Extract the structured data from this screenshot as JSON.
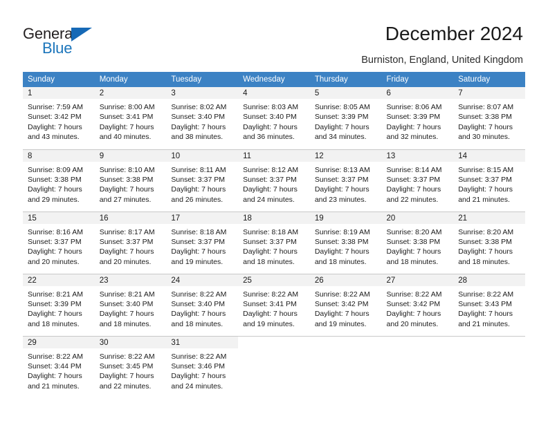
{
  "brand": {
    "name_part1": "General",
    "name_part2": "Blue",
    "triangle_color": "#1669b6",
    "blue_color": "#1b75bb"
  },
  "header": {
    "title": "December 2024",
    "location": "Burniston, England, United Kingdom"
  },
  "theme": {
    "header_row_bg": "#3c82c4",
    "daynum_band_bg": "#f2f2f2",
    "grid_line": "#c8c8c8"
  },
  "weekday_headers": [
    "Sunday",
    "Monday",
    "Tuesday",
    "Wednesday",
    "Thursday",
    "Friday",
    "Saturday"
  ],
  "weeks": [
    [
      {
        "day": "1",
        "sunrise": "Sunrise: 7:59 AM",
        "sunset": "Sunset: 3:42 PM",
        "daylight1": "Daylight: 7 hours",
        "daylight2": "and 43 minutes."
      },
      {
        "day": "2",
        "sunrise": "Sunrise: 8:00 AM",
        "sunset": "Sunset: 3:41 PM",
        "daylight1": "Daylight: 7 hours",
        "daylight2": "and 40 minutes."
      },
      {
        "day": "3",
        "sunrise": "Sunrise: 8:02 AM",
        "sunset": "Sunset: 3:40 PM",
        "daylight1": "Daylight: 7 hours",
        "daylight2": "and 38 minutes."
      },
      {
        "day": "4",
        "sunrise": "Sunrise: 8:03 AM",
        "sunset": "Sunset: 3:40 PM",
        "daylight1": "Daylight: 7 hours",
        "daylight2": "and 36 minutes."
      },
      {
        "day": "5",
        "sunrise": "Sunrise: 8:05 AM",
        "sunset": "Sunset: 3:39 PM",
        "daylight1": "Daylight: 7 hours",
        "daylight2": "and 34 minutes."
      },
      {
        "day": "6",
        "sunrise": "Sunrise: 8:06 AM",
        "sunset": "Sunset: 3:39 PM",
        "daylight1": "Daylight: 7 hours",
        "daylight2": "and 32 minutes."
      },
      {
        "day": "7",
        "sunrise": "Sunrise: 8:07 AM",
        "sunset": "Sunset: 3:38 PM",
        "daylight1": "Daylight: 7 hours",
        "daylight2": "and 30 minutes."
      }
    ],
    [
      {
        "day": "8",
        "sunrise": "Sunrise: 8:09 AM",
        "sunset": "Sunset: 3:38 PM",
        "daylight1": "Daylight: 7 hours",
        "daylight2": "and 29 minutes."
      },
      {
        "day": "9",
        "sunrise": "Sunrise: 8:10 AM",
        "sunset": "Sunset: 3:38 PM",
        "daylight1": "Daylight: 7 hours",
        "daylight2": "and 27 minutes."
      },
      {
        "day": "10",
        "sunrise": "Sunrise: 8:11 AM",
        "sunset": "Sunset: 3:37 PM",
        "daylight1": "Daylight: 7 hours",
        "daylight2": "and 26 minutes."
      },
      {
        "day": "11",
        "sunrise": "Sunrise: 8:12 AM",
        "sunset": "Sunset: 3:37 PM",
        "daylight1": "Daylight: 7 hours",
        "daylight2": "and 24 minutes."
      },
      {
        "day": "12",
        "sunrise": "Sunrise: 8:13 AM",
        "sunset": "Sunset: 3:37 PM",
        "daylight1": "Daylight: 7 hours",
        "daylight2": "and 23 minutes."
      },
      {
        "day": "13",
        "sunrise": "Sunrise: 8:14 AM",
        "sunset": "Sunset: 3:37 PM",
        "daylight1": "Daylight: 7 hours",
        "daylight2": "and 22 minutes."
      },
      {
        "day": "14",
        "sunrise": "Sunrise: 8:15 AM",
        "sunset": "Sunset: 3:37 PM",
        "daylight1": "Daylight: 7 hours",
        "daylight2": "and 21 minutes."
      }
    ],
    [
      {
        "day": "15",
        "sunrise": "Sunrise: 8:16 AM",
        "sunset": "Sunset: 3:37 PM",
        "daylight1": "Daylight: 7 hours",
        "daylight2": "and 20 minutes."
      },
      {
        "day": "16",
        "sunrise": "Sunrise: 8:17 AM",
        "sunset": "Sunset: 3:37 PM",
        "daylight1": "Daylight: 7 hours",
        "daylight2": "and 20 minutes."
      },
      {
        "day": "17",
        "sunrise": "Sunrise: 8:18 AM",
        "sunset": "Sunset: 3:37 PM",
        "daylight1": "Daylight: 7 hours",
        "daylight2": "and 19 minutes."
      },
      {
        "day": "18",
        "sunrise": "Sunrise: 8:18 AM",
        "sunset": "Sunset: 3:37 PM",
        "daylight1": "Daylight: 7 hours",
        "daylight2": "and 18 minutes."
      },
      {
        "day": "19",
        "sunrise": "Sunrise: 8:19 AM",
        "sunset": "Sunset: 3:38 PM",
        "daylight1": "Daylight: 7 hours",
        "daylight2": "and 18 minutes."
      },
      {
        "day": "20",
        "sunrise": "Sunrise: 8:20 AM",
        "sunset": "Sunset: 3:38 PM",
        "daylight1": "Daylight: 7 hours",
        "daylight2": "and 18 minutes."
      },
      {
        "day": "21",
        "sunrise": "Sunrise: 8:20 AM",
        "sunset": "Sunset: 3:38 PM",
        "daylight1": "Daylight: 7 hours",
        "daylight2": "and 18 minutes."
      }
    ],
    [
      {
        "day": "22",
        "sunrise": "Sunrise: 8:21 AM",
        "sunset": "Sunset: 3:39 PM",
        "daylight1": "Daylight: 7 hours",
        "daylight2": "and 18 minutes."
      },
      {
        "day": "23",
        "sunrise": "Sunrise: 8:21 AM",
        "sunset": "Sunset: 3:40 PM",
        "daylight1": "Daylight: 7 hours",
        "daylight2": "and 18 minutes."
      },
      {
        "day": "24",
        "sunrise": "Sunrise: 8:22 AM",
        "sunset": "Sunset: 3:40 PM",
        "daylight1": "Daylight: 7 hours",
        "daylight2": "and 18 minutes."
      },
      {
        "day": "25",
        "sunrise": "Sunrise: 8:22 AM",
        "sunset": "Sunset: 3:41 PM",
        "daylight1": "Daylight: 7 hours",
        "daylight2": "and 19 minutes."
      },
      {
        "day": "26",
        "sunrise": "Sunrise: 8:22 AM",
        "sunset": "Sunset: 3:42 PM",
        "daylight1": "Daylight: 7 hours",
        "daylight2": "and 19 minutes."
      },
      {
        "day": "27",
        "sunrise": "Sunrise: 8:22 AM",
        "sunset": "Sunset: 3:42 PM",
        "daylight1": "Daylight: 7 hours",
        "daylight2": "and 20 minutes."
      },
      {
        "day": "28",
        "sunrise": "Sunrise: 8:22 AM",
        "sunset": "Sunset: 3:43 PM",
        "daylight1": "Daylight: 7 hours",
        "daylight2": "and 21 minutes."
      }
    ],
    [
      {
        "day": "29",
        "sunrise": "Sunrise: 8:22 AM",
        "sunset": "Sunset: 3:44 PM",
        "daylight1": "Daylight: 7 hours",
        "daylight2": "and 21 minutes."
      },
      {
        "day": "30",
        "sunrise": "Sunrise: 8:22 AM",
        "sunset": "Sunset: 3:45 PM",
        "daylight1": "Daylight: 7 hours",
        "daylight2": "and 22 minutes."
      },
      {
        "day": "31",
        "sunrise": "Sunrise: 8:22 AM",
        "sunset": "Sunset: 3:46 PM",
        "daylight1": "Daylight: 7 hours",
        "daylight2": "and 24 minutes."
      },
      {
        "day": "",
        "sunrise": "",
        "sunset": "",
        "daylight1": "",
        "daylight2": ""
      },
      {
        "day": "",
        "sunrise": "",
        "sunset": "",
        "daylight1": "",
        "daylight2": ""
      },
      {
        "day": "",
        "sunrise": "",
        "sunset": "",
        "daylight1": "",
        "daylight2": ""
      },
      {
        "day": "",
        "sunrise": "",
        "sunset": "",
        "daylight1": "",
        "daylight2": ""
      }
    ]
  ]
}
